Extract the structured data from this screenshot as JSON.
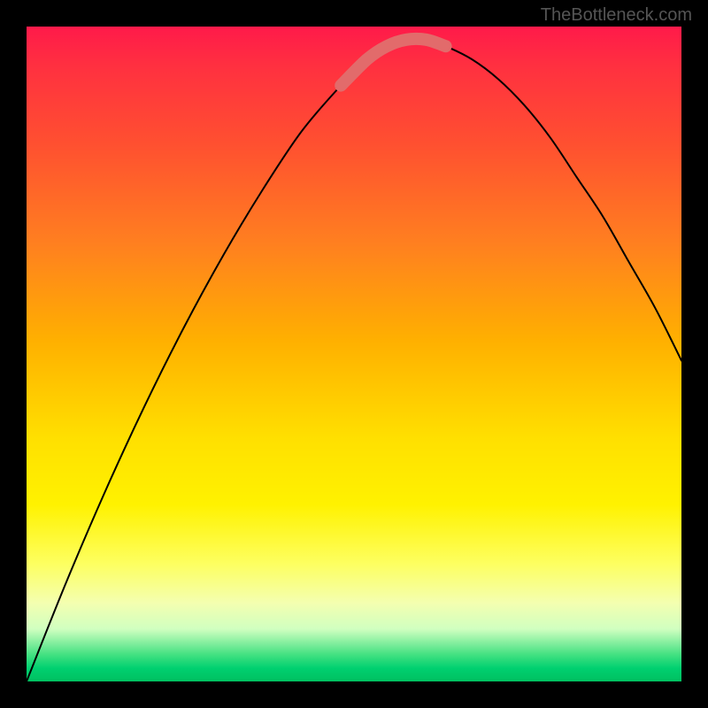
{
  "watermark": "TheBottleneck.com",
  "chart_data": {
    "type": "line",
    "title": "",
    "xlabel": "",
    "ylabel": "",
    "xlim": [
      0,
      100
    ],
    "ylim": [
      0,
      100
    ],
    "series": [
      {
        "name": "curve",
        "x": [
          0,
          6,
          12,
          18,
          24,
          30,
          36,
          42,
          48,
          52,
          55,
          58,
          61,
          64,
          68,
          72,
          76,
          80,
          84,
          88,
          92,
          96,
          100
        ],
        "y": [
          0,
          15,
          29,
          42,
          54,
          65,
          75,
          84,
          91,
          95,
          97,
          98,
          98,
          97,
          95,
          92,
          88,
          83,
          77,
          71,
          64,
          57,
          49
        ]
      }
    ],
    "highlight": {
      "name": "flat-bottom",
      "x_range": [
        48,
        64
      ],
      "color": "#e26b6b"
    }
  }
}
